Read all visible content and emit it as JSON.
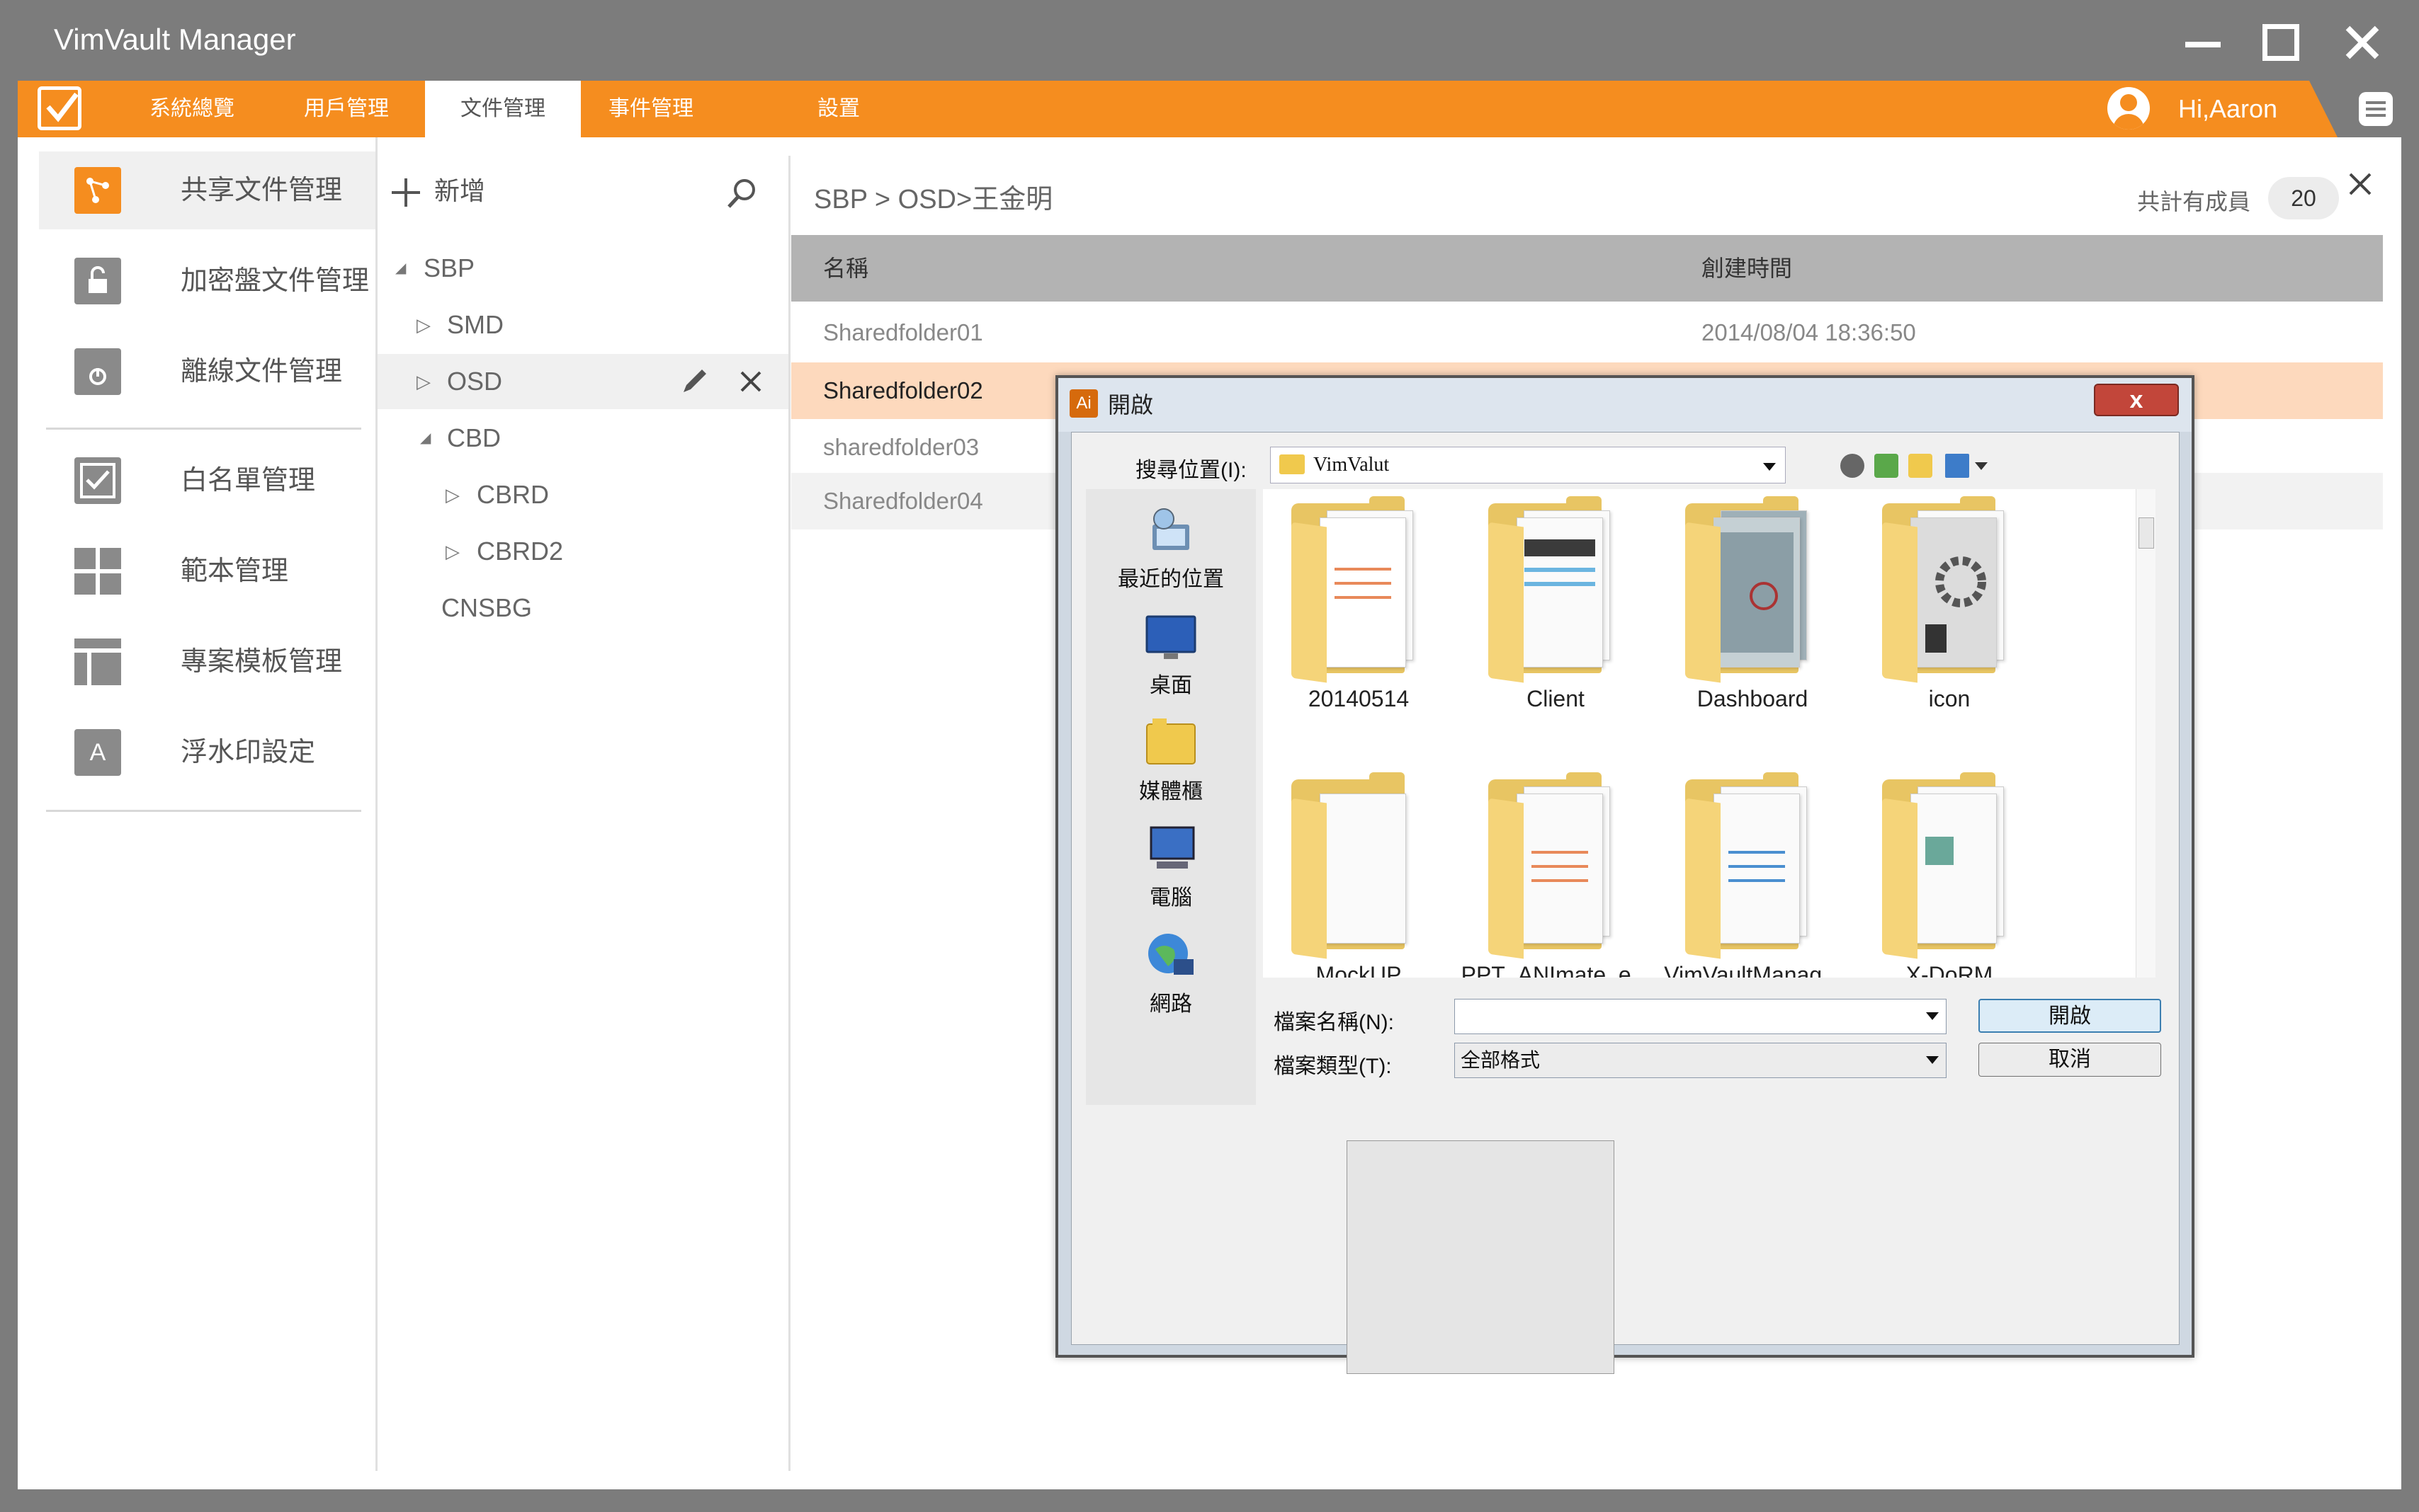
{
  "app": {
    "title": "VimVault Manager"
  },
  "menu": {
    "items": [
      {
        "label": "系統總覽"
      },
      {
        "label": "用戶管理"
      },
      {
        "label": "文件管理"
      },
      {
        "label": "事件管理"
      },
      {
        "label": "設置"
      }
    ],
    "active_index": 2,
    "user_greeting": "Hi,Aaron"
  },
  "sidebar": {
    "items": [
      {
        "label": "共享文件管理",
        "icon": "share-icon"
      },
      {
        "label": "加密盤文件管理",
        "icon": "lock-icon"
      },
      {
        "label": "離線文件管理",
        "icon": "offline-icon"
      },
      {
        "label": "白名單管理",
        "icon": "checkbox-icon"
      },
      {
        "label": "範本管理",
        "icon": "grid-icon"
      },
      {
        "label": "專案模板管理",
        "icon": "layout-icon"
      },
      {
        "label": "浮水印設定",
        "icon": "watermark-icon"
      }
    ],
    "watermark_letter": "A"
  },
  "tree": {
    "add_label": "新增",
    "nodes": [
      {
        "label": "SBP",
        "arrow": "◢"
      },
      {
        "label": "SMD",
        "arrow": "▷"
      },
      {
        "label": "OSD",
        "arrow": "▷"
      },
      {
        "label": "CBD",
        "arrow": "◢"
      },
      {
        "label": "CBRD",
        "arrow": "▷"
      },
      {
        "label": "CBRD2",
        "arrow": "▷"
      },
      {
        "label": "CNSBG",
        "arrow": ""
      }
    ]
  },
  "main": {
    "breadcrumb": "SBP > OSD>王金明",
    "member_label": "共計有成員",
    "member_count": "20",
    "columns": {
      "name": "名稱",
      "created": "創建時間"
    },
    "rows": [
      {
        "name": "Sharedfolder01",
        "created": "2014/08/04 18:36:50"
      },
      {
        "name": "Sharedfolder02",
        "created": ""
      },
      {
        "name": "sharedfolder03",
        "created": ""
      },
      {
        "name": "Sharedfolder04",
        "created": ""
      }
    ]
  },
  "dialog": {
    "title": "開啟",
    "app_badge": "Ai",
    "close_label": "x",
    "look_in_label": "搜尋位置(I):",
    "look_in_value": "VimValut",
    "places": [
      {
        "label": "最近的位置",
        "icon": "recent-places-icon"
      },
      {
        "label": "桌面",
        "icon": "desktop-icon"
      },
      {
        "label": "媒體櫃",
        "icon": "libraries-icon"
      },
      {
        "label": "電腦",
        "icon": "computer-icon"
      },
      {
        "label": "網路",
        "icon": "network-icon"
      }
    ],
    "files": [
      {
        "name": "20140514"
      },
      {
        "name": "Client"
      },
      {
        "name": "Dashboard"
      },
      {
        "name": "icon"
      },
      {
        "name": "MockUP"
      },
      {
        "name": "PPT_ANImate_e..."
      },
      {
        "name": "VimVaultManag..."
      },
      {
        "name": "X-DoRM"
      }
    ],
    "filename_label": "檔案名稱(N):",
    "filename_value": "",
    "filetype_label": "檔案類型(T):",
    "filetype_value": "全部格式",
    "open_button": "開啟",
    "cancel_button": "取消"
  },
  "colors": {
    "accent": "#f58d1f",
    "titlebar": "#7c7c7c",
    "table_header": "#b3b3b3",
    "selected_row": "#fdd9bd"
  }
}
